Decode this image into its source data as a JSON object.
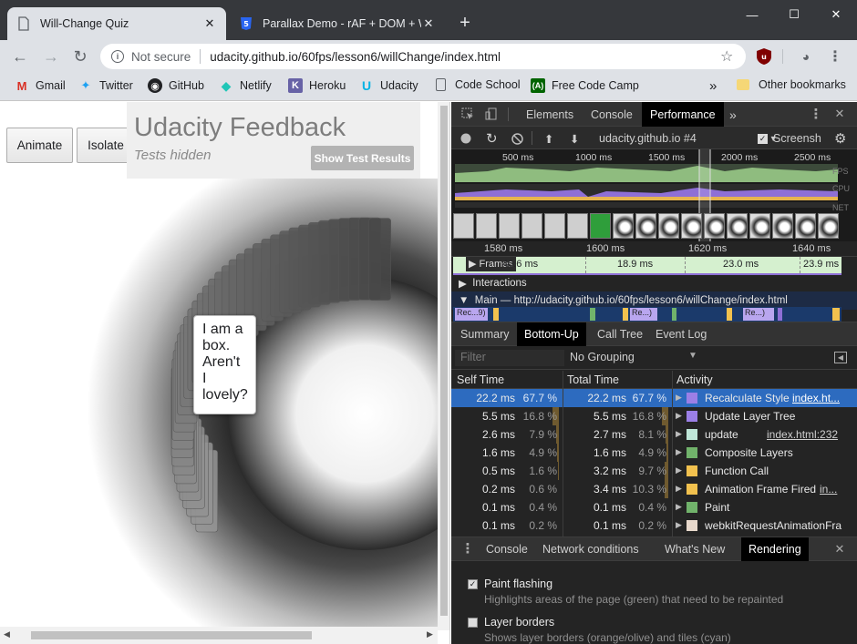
{
  "browser": {
    "tabs": [
      {
        "title": "Will-Change Quiz",
        "active": true
      },
      {
        "title": "Parallax Demo - rAF + DOM + W",
        "active": false
      }
    ],
    "new_tab": "+",
    "window_controls": {
      "minimize": "—",
      "maximize": "☐",
      "close": "✕"
    },
    "address": {
      "security_label": "Not secure",
      "url": "udacity.github.io/60fps/lesson6/willChange/index.html"
    },
    "bookmarks": [
      {
        "label": "Gmail",
        "icon": "gmail-icon",
        "color": "#d93025"
      },
      {
        "label": "Twitter",
        "icon": "twitter-icon",
        "color": "#1da1f2"
      },
      {
        "label": "GitHub",
        "icon": "github-icon",
        "color": "#202124"
      },
      {
        "label": "Netlify",
        "icon": "netlify-icon",
        "color": "#20c6b7"
      },
      {
        "label": "Heroku",
        "icon": "heroku-icon",
        "color": "#6762a6"
      },
      {
        "label": "Udacity",
        "icon": "udacity-icon",
        "color": "#02b3e4"
      },
      {
        "label": "Code School",
        "icon": "page-icon",
        "color": "#5f6368"
      },
      {
        "label": "Free Code Camp",
        "icon": "freecodecamp-icon",
        "color": "#006400"
      }
    ],
    "bookmarks_overflow": "»",
    "other_bookmarks": "Other bookmarks"
  },
  "page": {
    "buttons": {
      "animate": "Animate",
      "isolate": "Isolate"
    },
    "feedback": {
      "title": "Udacity Feedback",
      "subtitle": "Tests hidden",
      "button": "Show Test Results"
    },
    "box_text": "I am a box. Aren't I lovely?"
  },
  "devtools": {
    "tabs": [
      "Elements",
      "Console",
      "Performance"
    ],
    "selected_tab": "Performance",
    "more_tabs": "»",
    "target": "udacity.github.io #4",
    "screenshots_label": "Screensh",
    "overview_ruler": [
      "500 ms",
      "1000 ms",
      "1500 ms",
      "2000 ms",
      "2500 ms"
    ],
    "overview_tags": [
      "FPS",
      "CPU",
      "NET"
    ],
    "timeline_ruler": [
      "1580 ms",
      "1600 ms",
      "1620 ms",
      "1640 ms"
    ],
    "frames": {
      "label": "Frames",
      "durations": [
        "40.6 ms",
        "18.9 ms",
        "23.0 ms",
        "23.9 ms"
      ]
    },
    "interactions_label": "Interactions",
    "main_label": "Main — http://udacity.github.io/60fps/lesson6/willChange/index.html",
    "main_blocks": [
      "Rec...9)",
      "Re...)",
      "Re...)"
    ],
    "subtabs": [
      "Summary",
      "Bottom-Up",
      "Call Tree",
      "Event Log"
    ],
    "selected_subtab": "Bottom-Up",
    "filter_placeholder": "Filter",
    "grouping": "No Grouping",
    "columns": {
      "self": "Self Time",
      "total": "Total Time",
      "activity": "Activity"
    },
    "rows": [
      {
        "self": "22.2 ms",
        "self_pct": "67.7 %",
        "self_frac": 0.677,
        "total": "22.2 ms",
        "total_pct": "67.7 %",
        "total_frac": 0.677,
        "activity": "Recalculate Style",
        "link": "index.ht...",
        "color": "#9b7fe6"
      },
      {
        "self": "5.5 ms",
        "self_pct": "16.8 %",
        "self_frac": 0.168,
        "total": "5.5 ms",
        "total_pct": "16.8 %",
        "total_frac": 0.168,
        "activity": "Update Layer Tree",
        "link": "",
        "color": "#9b7fe6"
      },
      {
        "self": "2.6 ms",
        "self_pct": "7.9 %",
        "self_frac": 0.079,
        "total": "2.7 ms",
        "total_pct": "8.1 %",
        "total_frac": 0.081,
        "activity": "update",
        "link": "index.html:232",
        "color": "#bfe6d8"
      },
      {
        "self": "1.6 ms",
        "self_pct": "4.9 %",
        "self_frac": 0.049,
        "total": "1.6 ms",
        "total_pct": "4.9 %",
        "total_frac": 0.049,
        "activity": "Composite Layers",
        "link": "",
        "color": "#71b36b"
      },
      {
        "self": "0.5 ms",
        "self_pct": "1.6 %",
        "self_frac": 0.016,
        "total": "3.2 ms",
        "total_pct": "9.7 %",
        "total_frac": 0.097,
        "activity": "Function Call",
        "link": "",
        "color": "#f2c14e"
      },
      {
        "self": "0.2 ms",
        "self_pct": "0.6 %",
        "self_frac": 0.006,
        "total": "3.4 ms",
        "total_pct": "10.3 %",
        "total_frac": 0.103,
        "activity": "Animation Frame Fired",
        "link": "in...",
        "color": "#f2c14e"
      },
      {
        "self": "0.1 ms",
        "self_pct": "0.4 %",
        "self_frac": 0.004,
        "total": "0.1 ms",
        "total_pct": "0.4 %",
        "total_frac": 0.004,
        "activity": "Paint",
        "link": "",
        "color": "#71b36b"
      },
      {
        "self": "0.1 ms",
        "self_pct": "0.2 %",
        "self_frac": 0.002,
        "total": "0.1 ms",
        "total_pct": "0.2 %",
        "total_frac": 0.002,
        "activity": "webkitRequestAnimationFra",
        "link": "",
        "color": "#e8d9cc"
      }
    ],
    "drawer_tabs": [
      "Console",
      "Network conditions",
      "What's New",
      "Rendering"
    ],
    "selected_drawer_tab": "Rendering",
    "rendering_options": [
      {
        "title": "Paint flashing",
        "desc": "Highlights areas of the page (green) that need to be repainted",
        "checked": true
      },
      {
        "title": "Layer borders",
        "desc": "Shows layer borders (orange/olive) and tiles (cyan)",
        "checked": false
      }
    ]
  }
}
